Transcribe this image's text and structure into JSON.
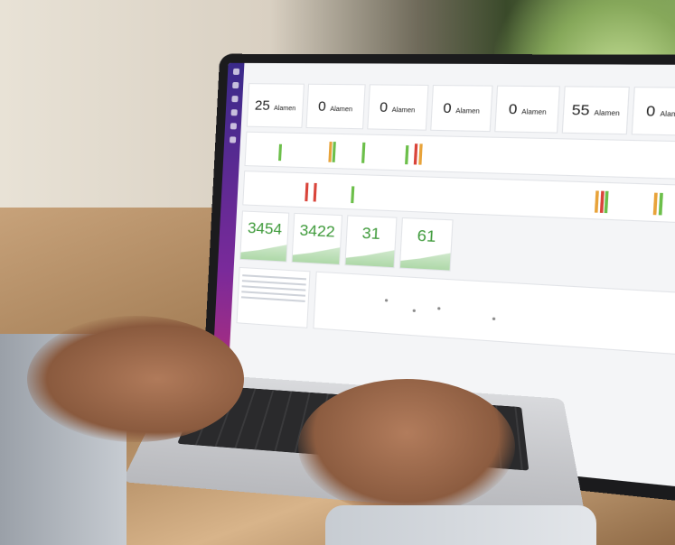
{
  "dashboard": {
    "alarm_unit": "Alamen",
    "alarm_counts": [
      "25",
      "0",
      "0",
      "0",
      "0",
      "55",
      "0"
    ],
    "kpis": [
      "3454",
      "3422",
      "31",
      "61"
    ]
  },
  "colors": {
    "sidebar_top": "#3a2a8a",
    "sidebar_bottom": "#d0306a",
    "kpi_green": "#3e9a3a",
    "alarm_green": "#6cbf4a",
    "alarm_red": "#d9443a",
    "alarm_orange": "#e8a33a"
  }
}
